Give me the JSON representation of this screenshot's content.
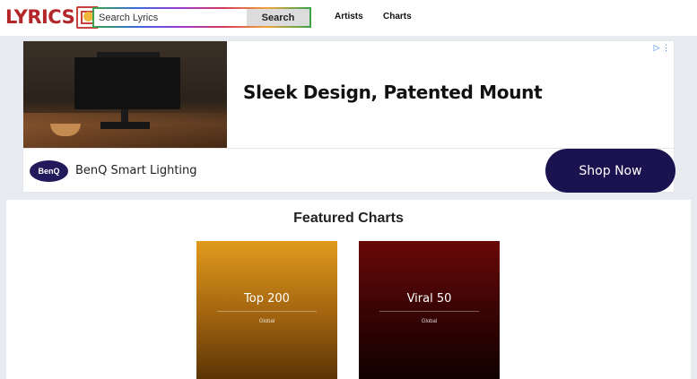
{
  "header": {
    "logo_text": "LYRICS",
    "search": {
      "placeholder": "Search Lyrics",
      "value": "",
      "button_label": "Search"
    },
    "nav": [
      {
        "label": "Artists"
      },
      {
        "label": "Charts"
      }
    ]
  },
  "ad": {
    "headline": "Sleek Design, Patented Mount",
    "brand_badge": "BenQ",
    "brand_name": "BenQ Smart Lighting",
    "cta_label": "Shop Now",
    "adchoices_icon": "adchoices-icon",
    "colors": {
      "cta_bg": "#1b1250",
      "badge_bg": "#221a5a"
    }
  },
  "featured": {
    "title": "Featured Charts",
    "cards": [
      {
        "title": "Top 200",
        "subtitle": "Global",
        "color": "#e09b1c"
      },
      {
        "title": "Viral 50",
        "subtitle": "Global",
        "color": "#6a0808"
      }
    ]
  },
  "colors": {
    "logo": "#b3262a",
    "page_bg": "#e8ecf1"
  }
}
